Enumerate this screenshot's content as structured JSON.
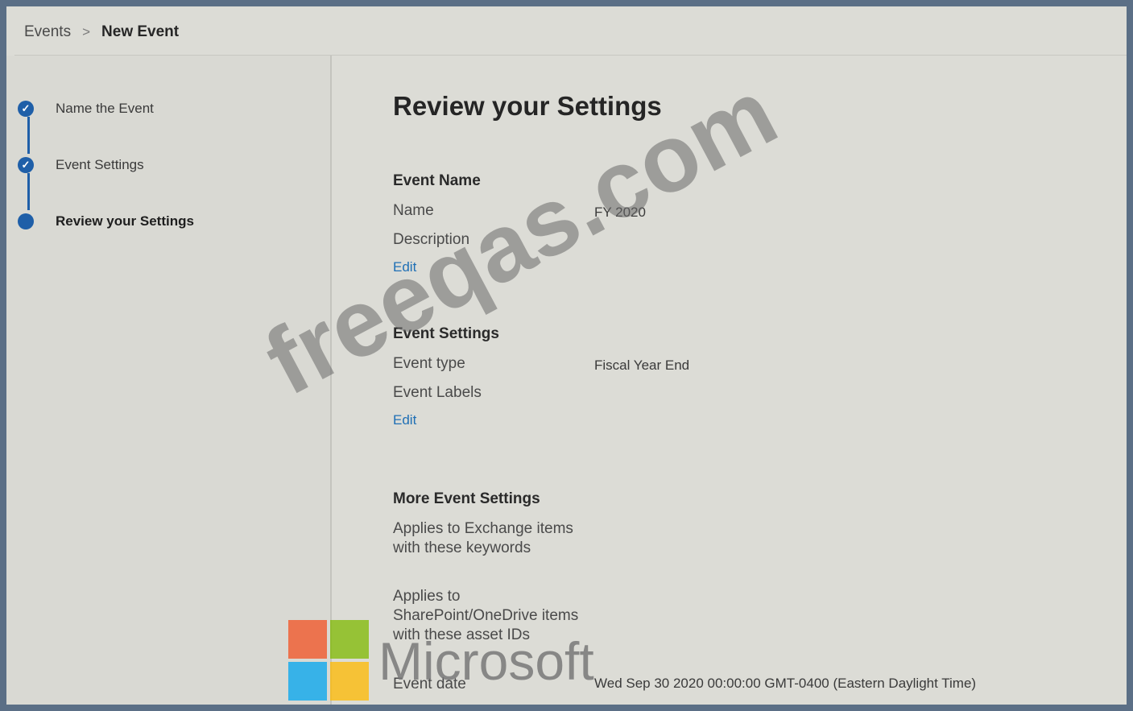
{
  "breadcrumb": {
    "parent": "Events",
    "separator": ">",
    "current": "New Event"
  },
  "steps": [
    {
      "label": "Name the Event",
      "status": "complete",
      "icon": "check-icon"
    },
    {
      "label": "Event Settings",
      "status": "complete",
      "icon": "check-icon"
    },
    {
      "label": "Review your Settings",
      "status": "current",
      "icon": "dot-icon"
    }
  ],
  "main": {
    "title": "Review your Settings",
    "event_name": {
      "title": "Event Name",
      "name_label": "Name",
      "name_value": "FY 2020",
      "description_label": "Description",
      "edit_label": "Edit"
    },
    "event_settings": {
      "title": "Event Settings",
      "type_label": "Event type",
      "type_value": "Fiscal Year End",
      "labels_label": "Event Labels",
      "edit_label": "Edit"
    },
    "more_settings": {
      "title": "More Event Settings",
      "exchange_label": "Applies to Exchange items with these keywords",
      "sharepoint_label": "Applies to SharePoint/OneDrive items with these asset IDs",
      "date_label": "Event date",
      "date_value": "Wed Sep 30 2020 00:00:00 GMT-0400 (Eastern Daylight Time)"
    }
  },
  "watermark": {
    "text": "freeqas.com"
  },
  "logo": {
    "text": "Microsoft",
    "colors": [
      "#f25022",
      "#7fba00",
      "#00a4ef",
      "#ffb900"
    ]
  },
  "accent_color": "#1f5fa8",
  "link_color": "#1f6fb5"
}
